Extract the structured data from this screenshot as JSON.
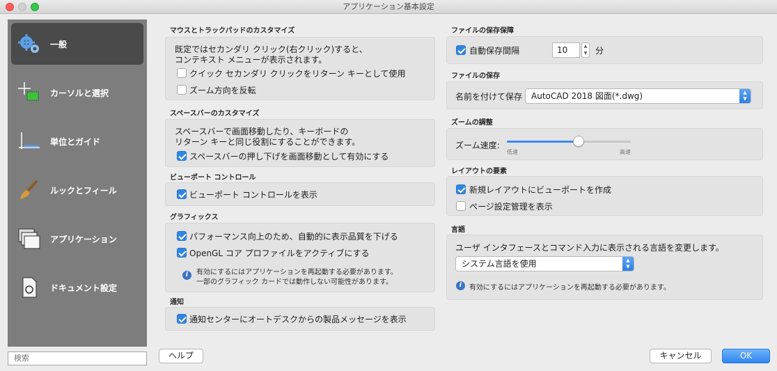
{
  "window": {
    "title": "アプリケーション基本設定"
  },
  "sidebar": {
    "items": [
      {
        "label": "一般",
        "icon": "gears-icon"
      },
      {
        "label": "カーソルと選択",
        "icon": "cursor-icon"
      },
      {
        "label": "単位とガイド",
        "icon": "ruler-icon"
      },
      {
        "label": "ルックとフィール",
        "icon": "brush-icon"
      },
      {
        "label": "アプリケーション",
        "icon": "windows-icon"
      },
      {
        "label": "ドキュメント設定",
        "icon": "document-icon"
      }
    ],
    "search_placeholder": "検索"
  },
  "mouse": {
    "title": "マウスとトラックパッドのカスタマイズ",
    "desc1": "既定ではセカンダリ クリック(右クリック)すると、",
    "desc2": "コンテキスト メニューが表示されます。",
    "opt1": "クイック セカンダリ クリックをリターン キーとして使用",
    "opt2": "ズーム方向を反転"
  },
  "spacebar": {
    "title": "スペースバーのカスタマイズ",
    "desc1": "スペースバーで画面移動したり、キーボードの",
    "desc2": "リターン キーと同じ役割にすることができます。",
    "opt1": "スペースバーの押し下げを画面移動として有効にする"
  },
  "viewport": {
    "title": "ビューポート コントロール",
    "opt1": "ビューポート コントロールを表示"
  },
  "graphics": {
    "title": "グラフィックス",
    "opt1": "パフォーマンス向上のため、自動的に表示品質を下げる",
    "opt2": "OpenGL コア プロファイルをアクティブにする",
    "note1": "有効にするにはアプリケーションを再起動する必要があります。",
    "note2": "一部のグラフィック カードでは動作しない可能性があります。"
  },
  "notify": {
    "title": "通知",
    "opt1": "通知センターにオートデスクからの製品メッセージを表示"
  },
  "filesafety": {
    "title": "ファイルの保存保障",
    "autosave_label": "自動保存間隔",
    "autosave_value": "10",
    "autosave_unit": "分"
  },
  "filesave": {
    "title": "ファイルの保存",
    "saveas_label": "名前を付けて保存",
    "saveas_value": "AutoCAD 2018 図面(*.dwg)"
  },
  "zoom": {
    "title": "ズームの調整",
    "speed_label": "ズーム速度:",
    "low_label": "低速",
    "high_label": "高速",
    "speed_fraction": 0.58
  },
  "layout": {
    "title": "レイアウトの要素",
    "opt1": "新規レイアウトにビューポートを作成",
    "opt2": "ページ設定管理を表示"
  },
  "language": {
    "title": "言語",
    "desc": "ユーザ インタフェースとコマンド入力に表示される言語を変更します。",
    "select_value": "システム言語を使用",
    "note": "有効にするにはアプリケーションを再起動する必要があります。"
  },
  "buttons": {
    "help": "ヘルプ",
    "cancel": "キャンセル",
    "ok": "OK"
  },
  "colors": {
    "accent": "#2f86e4",
    "sidebar": "#7d7d7d",
    "sidebar_active": "#4a4a4a"
  }
}
